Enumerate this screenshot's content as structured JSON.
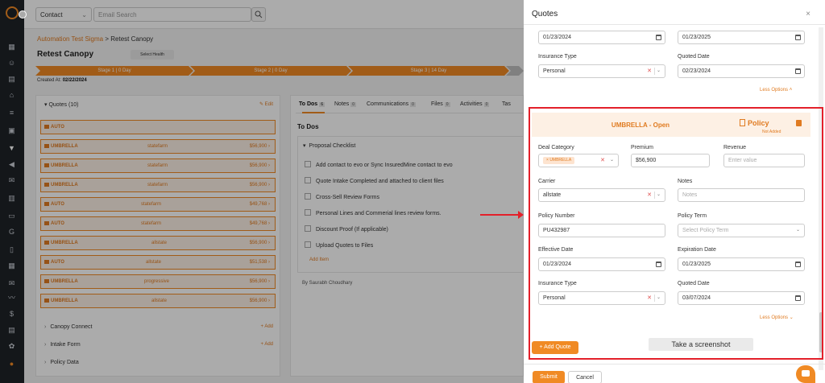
{
  "topbar": {
    "contact_select": "Contact",
    "search_placeholder": "Email Search"
  },
  "main": {
    "breadcrumb_parent": "Automation Test Sigma",
    "breadcrumb_sep": " > ",
    "breadcrumb_current": "Retest Canopy",
    "title": "Retest Canopy",
    "health_select": "Select Health",
    "stages": [
      "Stage 1 | 0 Day",
      "Stage 2 | 0 Day",
      "Stage 3 | 14 Day"
    ],
    "created_label": "Created At:",
    "created_value": "02/22/2024",
    "quotes_header": "Quotes (10)",
    "edit_label": "Edit",
    "quote_rows": [
      {
        "type": "AUTO",
        "carrier": "",
        "amount": ""
      },
      {
        "type": "UMBRELLA",
        "carrier": "statefarm",
        "amount": "$56,900"
      },
      {
        "type": "UMBRELLA",
        "carrier": "statefarm",
        "amount": "$56,900"
      },
      {
        "type": "UMBRELLA",
        "carrier": "statefarm",
        "amount": "$56,900"
      },
      {
        "type": "AUTO",
        "carrier": "statefarm",
        "amount": "$49,768"
      },
      {
        "type": "AUTO",
        "carrier": "statefarm",
        "amount": "$49,768"
      },
      {
        "type": "UMBRELLA",
        "carrier": "allstate",
        "amount": "$56,900"
      },
      {
        "type": "AUTO",
        "carrier": "allstate",
        "amount": "$51,538"
      },
      {
        "type": "UMBRELLA",
        "carrier": "progressive",
        "amount": "$56,900"
      },
      {
        "type": "UMBRELLA",
        "carrier": "allstate",
        "amount": "$56,900"
      }
    ],
    "sections": [
      {
        "label": "Canopy Connect",
        "add": "Add"
      },
      {
        "label": "Intake Form",
        "add": "Add"
      },
      {
        "label": "Policy Data",
        "add": ""
      }
    ],
    "tabs": [
      {
        "label": "To Dos",
        "count": "6"
      },
      {
        "label": "Notes",
        "count": "0"
      },
      {
        "label": "Communications",
        "count": "0"
      },
      {
        "label": "Files",
        "count": "0"
      },
      {
        "label": "Activities",
        "count": "0"
      },
      {
        "label": "Tas",
        "count": ""
      }
    ],
    "todos_title": "To Dos",
    "checklist_title": "Proposal Checklist",
    "checklist_items": [
      "Add contact to evo or Sync InsuredMine contact to evo",
      "Quote Intake Completed and attached to client files",
      "Cross-Sell Review Forms",
      "Personal Lines and Commerial lines review forms.",
      "Discount Proof (If applicable)",
      "Upload Quotes to Files"
    ],
    "add_item": "Add Item",
    "byline": "By Saurabh Choudhary"
  },
  "panel": {
    "title": "Quotes",
    "close": "×",
    "top_effective_date": "01/23/2024",
    "top_expiration_date": "01/23/2025",
    "insurance_type_label": "Insurance Type",
    "top_insurance_type": "Personal",
    "quoted_date_label": "Quoted Date",
    "top_quoted_date": "02/23/2024",
    "less_options": "Less Options",
    "quote_header": "UMBRELLA - Open",
    "policy_label": "Policy",
    "not_added": "Not Added",
    "deal_category_label": "Deal Category",
    "deal_category_value": "UMBRELLA",
    "premium_label": "Premium",
    "premium_value": "$56,900",
    "revenue_label": "Revenue",
    "revenue_placeholder": "Enter value",
    "carrier_label": "Carrier",
    "carrier_value": "allstate",
    "notes_label": "Notes",
    "notes_placeholder": "Notes",
    "policy_number_label": "Policy Number",
    "policy_number_value": "PU432987",
    "policy_term_label": "Policy Term",
    "policy_term_placeholder": "Select Policy Term",
    "effective_date_label": "Effective Date",
    "effective_date_value": "01/23/2024",
    "expiration_date_label": "Expiration Date",
    "expiration_date_value": "01/23/2025",
    "insurance_type_value": "Personal",
    "quoted_date_value": "03/07/2024",
    "add_quote": "+ Add Quote",
    "tooltip": "Take a screenshot",
    "submit": "Submit",
    "cancel": "Cancel"
  },
  "colors": {
    "accent": "#f08a24",
    "highlight": "#e3202a"
  }
}
